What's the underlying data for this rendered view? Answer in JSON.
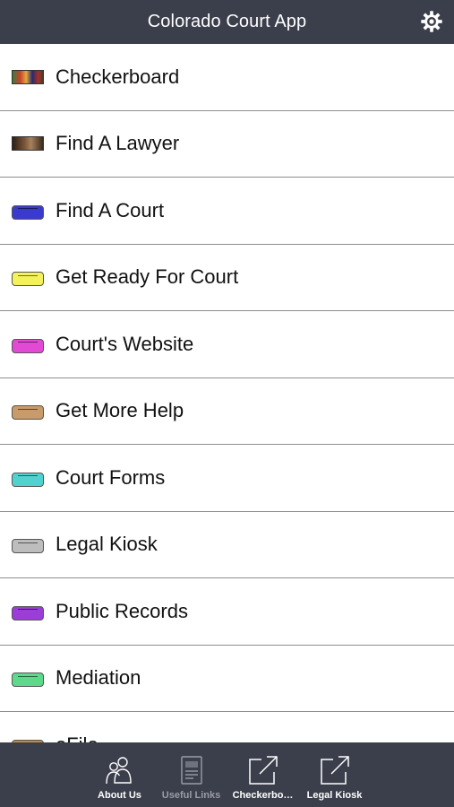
{
  "header": {
    "title": "Colorado Court App",
    "settings_icon": "gear-icon"
  },
  "menu": [
    {
      "label": "Checkerboard",
      "thumb_color": "#8a3b2a"
    },
    {
      "label": "Find A Lawyer",
      "thumb_color": "#6b4a34"
    },
    {
      "label": "Find A Court",
      "thumb_color": "#3a3acf"
    },
    {
      "label": "Get Ready For Court",
      "thumb_color": "#f4f25a"
    },
    {
      "label": "Court's Website",
      "thumb_color": "#e24ad6"
    },
    {
      "label": "Get More Help",
      "thumb_color": "#c99a6a"
    },
    {
      "label": "Court Forms",
      "thumb_color": "#52d2cf"
    },
    {
      "label": "Legal Kiosk",
      "thumb_color": "#bdbdbd"
    },
    {
      "label": "Public Records",
      "thumb_color": "#9b3ed8"
    },
    {
      "label": "Mediation",
      "thumb_color": "#5ed98b"
    },
    {
      "label": "eFile",
      "thumb_color": "#c9883e"
    }
  ],
  "tabbar": {
    "tabs": [
      {
        "label": "About Us",
        "icon": "people-icon",
        "active": false
      },
      {
        "label": "Useful Links",
        "icon": "document-icon",
        "active": true
      },
      {
        "label": "Checkerbo…",
        "icon": "external-link-icon",
        "active": false
      },
      {
        "label": "Legal Kiosk",
        "icon": "external-link-icon",
        "active": false
      }
    ]
  }
}
